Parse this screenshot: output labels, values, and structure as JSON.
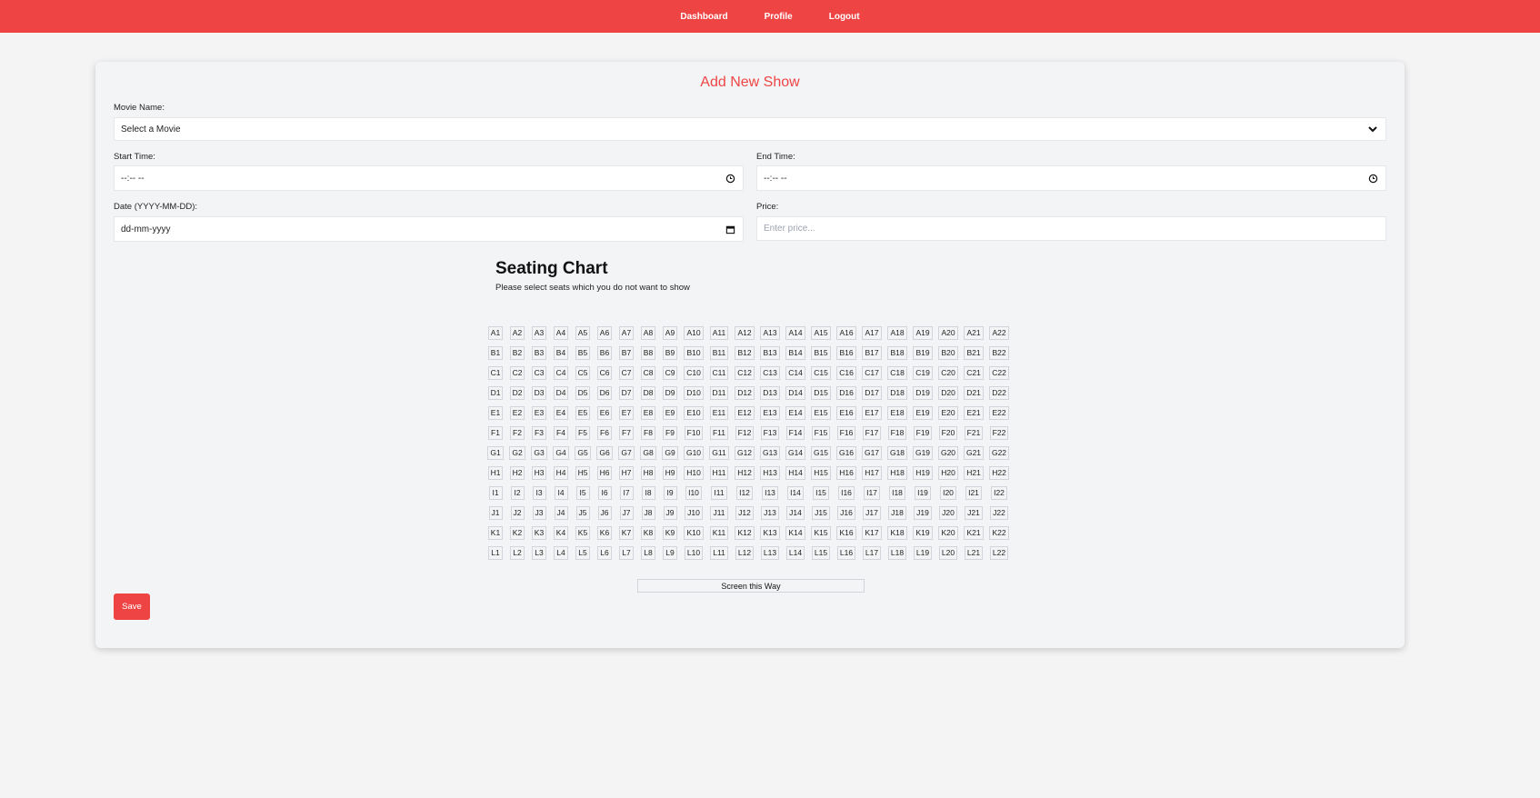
{
  "nav": {
    "dashboard": "Dashboard",
    "profile": "Profile",
    "logout": "Logout"
  },
  "form": {
    "title": "Add New Show",
    "movie_label": "Movie Name:",
    "movie_value": "Select a Movie",
    "start_label": "Start Time:",
    "start_value": "--:-- --",
    "end_label": "End Time:",
    "end_value": "--:-- --",
    "date_label": "Date (YYYY-MM-DD):",
    "date_value": "dd-mm-yyyy",
    "price_label": "Price:",
    "price_placeholder": "Enter price...",
    "save_label": "Save"
  },
  "seating": {
    "title": "Seating Chart",
    "subtitle": "Please select seats which you do not want to show",
    "rows": [
      "A",
      "B",
      "C",
      "D",
      "E",
      "F",
      "G",
      "H",
      "I",
      "J",
      "K",
      "L"
    ],
    "seats_per_row": 22,
    "screen_label": "Screen this Way"
  },
  "colors": {
    "accent": "#ef4444",
    "background": "#f4f4f5"
  },
  "icons": {
    "select": "chevron-down-icon",
    "time": "clock-icon",
    "date": "calendar-icon"
  }
}
